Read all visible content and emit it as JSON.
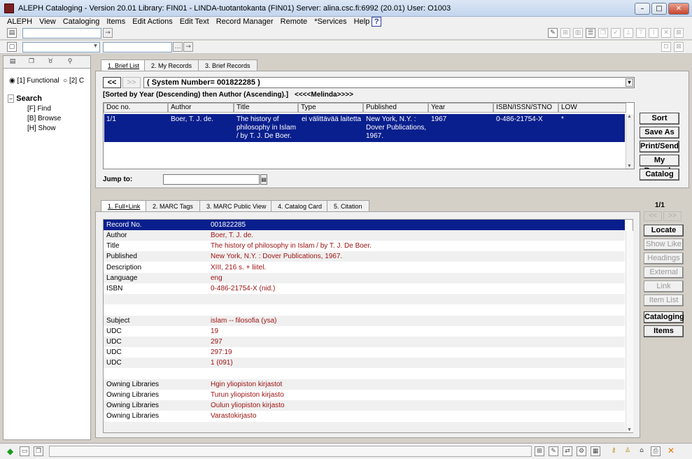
{
  "window": {
    "title": "ALEPH Cataloging - Version 20.01  Library:  FIN01 - LINDA-tuotantokanta (FIN01)  Server:  alina.csc.fi:6992 (20.01)  User:  O1003"
  },
  "menu": [
    "ALEPH",
    "View",
    "Cataloging",
    "Items",
    "Edit Actions",
    "Edit Text",
    "Record Manager",
    "Remote",
    "*Services",
    "Help"
  ],
  "help_icon": "?",
  "left": {
    "radio1": "[1] Functional",
    "radio2": "[2] C",
    "tree_title": "Search",
    "tree_items": [
      "[F] Find",
      "[B] Browse",
      "[H] Show"
    ]
  },
  "upper": {
    "tabs": [
      "1. Brief List",
      "2. My Records",
      "3. Brief Records"
    ],
    "nav_prev": "<<",
    "nav_next": ">>",
    "query": "( System Number= 001822285 )",
    "sort_info": "[Sorted by Year (Descending) then Author (Ascending).]",
    "base_info": "<<<<Melinda>>>>",
    "columns": [
      "Doc no.",
      "Author",
      "Title",
      "Type",
      "Published",
      "Year",
      "ISBN/ISSN/STNO",
      "LOW"
    ],
    "row": {
      "doc": "1/1",
      "author": "Boer, T. J. de.",
      "title": "The history of\nphilosophy in Islam\n/ by T. J. De Boer.",
      "type": "ei välittävää laitetta",
      "published": "New York, N.Y. :\nDover Publications,\n1967.",
      "year": "1967",
      "isbn": "0-486-21754-X",
      "low": "*"
    },
    "jump_label": "Jump to:",
    "buttons": [
      "Sort",
      "Save As",
      "Print/Send",
      "My Records",
      "Catalog"
    ]
  },
  "lower": {
    "tabs": [
      "1. Full+Link",
      "2. MARC Tags",
      "3. MARC Public View",
      "4. Catalog Card",
      "5. Citation"
    ],
    "counter": "1/1",
    "nav_prev": "<<",
    "nav_next": ">>",
    "header": {
      "label": "Record No.",
      "value": "001822285"
    },
    "rows": [
      {
        "label": "Author",
        "value": "Boer, T. J. de."
      },
      {
        "label": "Title",
        "value": "The history of philosophy in Islam / by T. J. De Boer."
      },
      {
        "label": "Published",
        "value": "New York, N.Y. : Dover Publications, 1967."
      },
      {
        "label": "Description",
        "value": "XIII, 216 s. +  liitel."
      },
      {
        "label": "Language",
        "value": "eng"
      },
      {
        "label": "ISBN",
        "value": "0-486-21754-X (nid.)"
      },
      {
        "label": "",
        "value": ""
      },
      {
        "label": "",
        "value": ""
      },
      {
        "label": "Subject",
        "value": "islam -- filosofia (ysa)"
      },
      {
        "label": "UDC",
        "value": "19"
      },
      {
        "label": "UDC",
        "value": "297"
      },
      {
        "label": "UDC",
        "value": "297:19"
      },
      {
        "label": "UDC",
        "value": "1 (091)"
      },
      {
        "label": "",
        "value": ""
      },
      {
        "label": "Owning Libraries",
        "value": "Hgin yliopiston kirjastot"
      },
      {
        "label": "Owning Libraries",
        "value": "Turun yliopiston kirjasto"
      },
      {
        "label": "Owning Libraries",
        "value": "Oulun yliopiston kirjasto"
      },
      {
        "label": "Owning Libraries",
        "value": "Varastokirjasto"
      },
      {
        "label": "",
        "value": ""
      }
    ],
    "buttons": [
      {
        "label": "Locate",
        "enabled": true
      },
      {
        "label": "Show Like",
        "enabled": false
      },
      {
        "label": "Headings",
        "enabled": false
      },
      {
        "label": "External",
        "enabled": false
      },
      {
        "label": "Link",
        "enabled": false
      },
      {
        "label": "Item List",
        "enabled": false
      },
      {
        "label": "Cataloging",
        "enabled": true
      },
      {
        "label": "Items",
        "enabled": true
      }
    ]
  },
  "colors": {
    "selection": "#0a1f8e",
    "value_text": "#9c1010"
  }
}
